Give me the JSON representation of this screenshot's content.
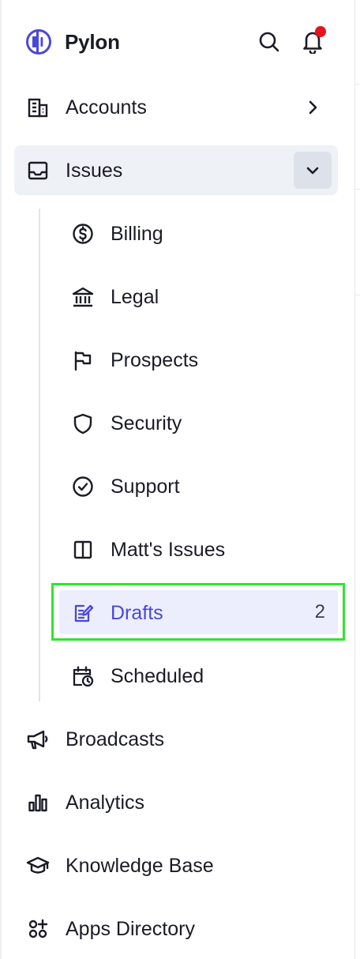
{
  "app": {
    "name": "Pylon",
    "logo_icon": "pylon-logo-icon"
  },
  "header": {
    "search_icon": "search-icon",
    "notification_icon": "bell-icon",
    "notification_dot_color": "#e8121f"
  },
  "nav": {
    "accounts": {
      "label": "Accounts",
      "icon": "building-icon"
    },
    "issues": {
      "label": "Issues",
      "icon": "inbox-icon",
      "expanded": true,
      "children": [
        {
          "label": "Billing",
          "icon": "dollar-circle-icon"
        },
        {
          "label": "Legal",
          "icon": "bank-icon"
        },
        {
          "label": "Prospects",
          "icon": "flag-icon"
        },
        {
          "label": "Security",
          "icon": "shield-icon"
        },
        {
          "label": "Support",
          "icon": "check-circle-icon"
        },
        {
          "label": "Matt's Issues",
          "icon": "columns-icon"
        },
        {
          "label": "Drafts",
          "icon": "edit-note-icon",
          "count": "2",
          "selected": true
        },
        {
          "label": "Scheduled",
          "icon": "calendar-clock-icon"
        }
      ]
    },
    "broadcasts": {
      "label": "Broadcasts",
      "icon": "megaphone-icon"
    },
    "analytics": {
      "label": "Analytics",
      "icon": "bar-chart-icon"
    },
    "knowledge_base": {
      "label": "Knowledge Base",
      "icon": "graduation-cap-icon"
    },
    "apps_directory": {
      "label": "Apps Directory",
      "icon": "apps-plus-icon"
    }
  },
  "colors": {
    "accent": "#4a48d8",
    "selected_bg": "#eceefe",
    "text": "#1a1b25",
    "section_bg": "#eef1f6"
  }
}
